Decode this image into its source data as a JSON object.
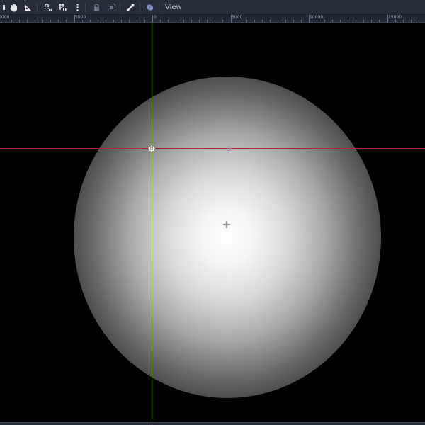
{
  "toolbar": {
    "tools": [
      {
        "name": "pan-tool",
        "icon": "hand-icon"
      },
      {
        "name": "ruler-tool",
        "icon": "ruler-icon"
      },
      {
        "name": "smart-snap-toggle",
        "icon": "magnet-snap-icon"
      },
      {
        "name": "grid-snap-toggle",
        "icon": "grid-snap-icon"
      },
      {
        "name": "snap-options-menu",
        "icon": "more-vertical-icon"
      },
      {
        "name": "lock-selected",
        "icon": "lock-icon"
      },
      {
        "name": "group-selected",
        "icon": "group-icon"
      },
      {
        "name": "skeleton-options",
        "icon": "bone-icon"
      },
      {
        "name": "camera-override",
        "icon": "camera-icon"
      }
    ],
    "view_menu_label": "View"
  },
  "ruler": {
    "labels": [
      "0000",
      "5000",
      "0",
      "5000",
      "10000",
      "15000"
    ]
  },
  "colors": {
    "toolbar_bg": "#272d3b",
    "ruler_bg": "#222836",
    "viewport_bg": "#000000",
    "x_axis": "#b2242b",
    "y_axis": "#6aa01c",
    "light": "#ffffff"
  }
}
